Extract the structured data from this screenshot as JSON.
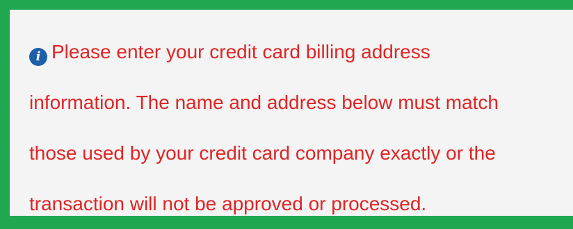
{
  "notice": {
    "icon": "info-icon",
    "icon_glyph": "i",
    "text_color": "#e02424",
    "lines": [
      "Please enter your credit card billing address",
      "information. The name and address below must match",
      "those used by your credit card company exactly or the",
      "transaction will not be approved or processed."
    ]
  },
  "colors": {
    "border": "#1fa84f",
    "panel_background": "#f4f4f4",
    "icon_background": "#1d5fa8"
  }
}
